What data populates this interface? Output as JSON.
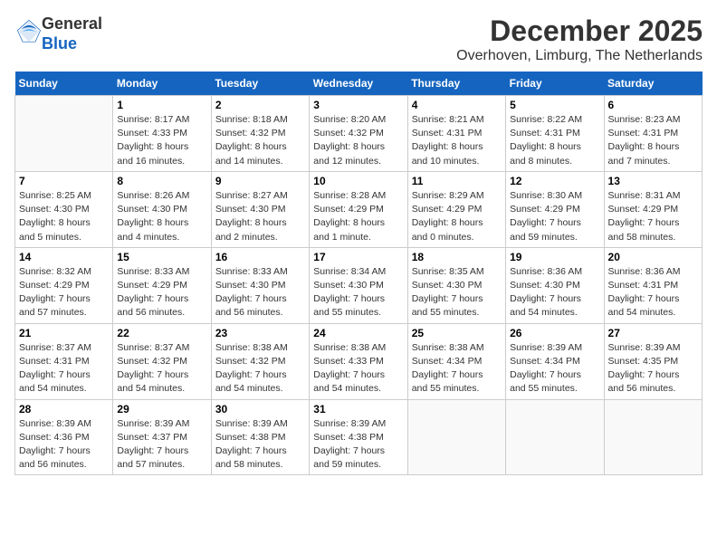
{
  "logo": {
    "general": "General",
    "blue": "Blue"
  },
  "header": {
    "month": "December 2025",
    "location": "Overhoven, Limburg, The Netherlands"
  },
  "days_of_week": [
    "Sunday",
    "Monday",
    "Tuesday",
    "Wednesday",
    "Thursday",
    "Friday",
    "Saturday"
  ],
  "weeks": [
    [
      {
        "day": "",
        "info": ""
      },
      {
        "day": "1",
        "info": "Sunrise: 8:17 AM\nSunset: 4:33 PM\nDaylight: 8 hours\nand 16 minutes."
      },
      {
        "day": "2",
        "info": "Sunrise: 8:18 AM\nSunset: 4:32 PM\nDaylight: 8 hours\nand 14 minutes."
      },
      {
        "day": "3",
        "info": "Sunrise: 8:20 AM\nSunset: 4:32 PM\nDaylight: 8 hours\nand 12 minutes."
      },
      {
        "day": "4",
        "info": "Sunrise: 8:21 AM\nSunset: 4:31 PM\nDaylight: 8 hours\nand 10 minutes."
      },
      {
        "day": "5",
        "info": "Sunrise: 8:22 AM\nSunset: 4:31 PM\nDaylight: 8 hours\nand 8 minutes."
      },
      {
        "day": "6",
        "info": "Sunrise: 8:23 AM\nSunset: 4:31 PM\nDaylight: 8 hours\nand 7 minutes."
      }
    ],
    [
      {
        "day": "7",
        "info": "Sunrise: 8:25 AM\nSunset: 4:30 PM\nDaylight: 8 hours\nand 5 minutes."
      },
      {
        "day": "8",
        "info": "Sunrise: 8:26 AM\nSunset: 4:30 PM\nDaylight: 8 hours\nand 4 minutes."
      },
      {
        "day": "9",
        "info": "Sunrise: 8:27 AM\nSunset: 4:30 PM\nDaylight: 8 hours\nand 2 minutes."
      },
      {
        "day": "10",
        "info": "Sunrise: 8:28 AM\nSunset: 4:29 PM\nDaylight: 8 hours\nand 1 minute."
      },
      {
        "day": "11",
        "info": "Sunrise: 8:29 AM\nSunset: 4:29 PM\nDaylight: 8 hours\nand 0 minutes."
      },
      {
        "day": "12",
        "info": "Sunrise: 8:30 AM\nSunset: 4:29 PM\nDaylight: 7 hours\nand 59 minutes."
      },
      {
        "day": "13",
        "info": "Sunrise: 8:31 AM\nSunset: 4:29 PM\nDaylight: 7 hours\nand 58 minutes."
      }
    ],
    [
      {
        "day": "14",
        "info": "Sunrise: 8:32 AM\nSunset: 4:29 PM\nDaylight: 7 hours\nand 57 minutes."
      },
      {
        "day": "15",
        "info": "Sunrise: 8:33 AM\nSunset: 4:29 PM\nDaylight: 7 hours\nand 56 minutes."
      },
      {
        "day": "16",
        "info": "Sunrise: 8:33 AM\nSunset: 4:30 PM\nDaylight: 7 hours\nand 56 minutes."
      },
      {
        "day": "17",
        "info": "Sunrise: 8:34 AM\nSunset: 4:30 PM\nDaylight: 7 hours\nand 55 minutes."
      },
      {
        "day": "18",
        "info": "Sunrise: 8:35 AM\nSunset: 4:30 PM\nDaylight: 7 hours\nand 55 minutes."
      },
      {
        "day": "19",
        "info": "Sunrise: 8:36 AM\nSunset: 4:30 PM\nDaylight: 7 hours\nand 54 minutes."
      },
      {
        "day": "20",
        "info": "Sunrise: 8:36 AM\nSunset: 4:31 PM\nDaylight: 7 hours\nand 54 minutes."
      }
    ],
    [
      {
        "day": "21",
        "info": "Sunrise: 8:37 AM\nSunset: 4:31 PM\nDaylight: 7 hours\nand 54 minutes."
      },
      {
        "day": "22",
        "info": "Sunrise: 8:37 AM\nSunset: 4:32 PM\nDaylight: 7 hours\nand 54 minutes."
      },
      {
        "day": "23",
        "info": "Sunrise: 8:38 AM\nSunset: 4:32 PM\nDaylight: 7 hours\nand 54 minutes."
      },
      {
        "day": "24",
        "info": "Sunrise: 8:38 AM\nSunset: 4:33 PM\nDaylight: 7 hours\nand 54 minutes."
      },
      {
        "day": "25",
        "info": "Sunrise: 8:38 AM\nSunset: 4:34 PM\nDaylight: 7 hours\nand 55 minutes."
      },
      {
        "day": "26",
        "info": "Sunrise: 8:39 AM\nSunset: 4:34 PM\nDaylight: 7 hours\nand 55 minutes."
      },
      {
        "day": "27",
        "info": "Sunrise: 8:39 AM\nSunset: 4:35 PM\nDaylight: 7 hours\nand 56 minutes."
      }
    ],
    [
      {
        "day": "28",
        "info": "Sunrise: 8:39 AM\nSunset: 4:36 PM\nDaylight: 7 hours\nand 56 minutes."
      },
      {
        "day": "29",
        "info": "Sunrise: 8:39 AM\nSunset: 4:37 PM\nDaylight: 7 hours\nand 57 minutes."
      },
      {
        "day": "30",
        "info": "Sunrise: 8:39 AM\nSunset: 4:38 PM\nDaylight: 7 hours\nand 58 minutes."
      },
      {
        "day": "31",
        "info": "Sunrise: 8:39 AM\nSunset: 4:38 PM\nDaylight: 7 hours\nand 59 minutes."
      },
      {
        "day": "",
        "info": ""
      },
      {
        "day": "",
        "info": ""
      },
      {
        "day": "",
        "info": ""
      }
    ]
  ]
}
